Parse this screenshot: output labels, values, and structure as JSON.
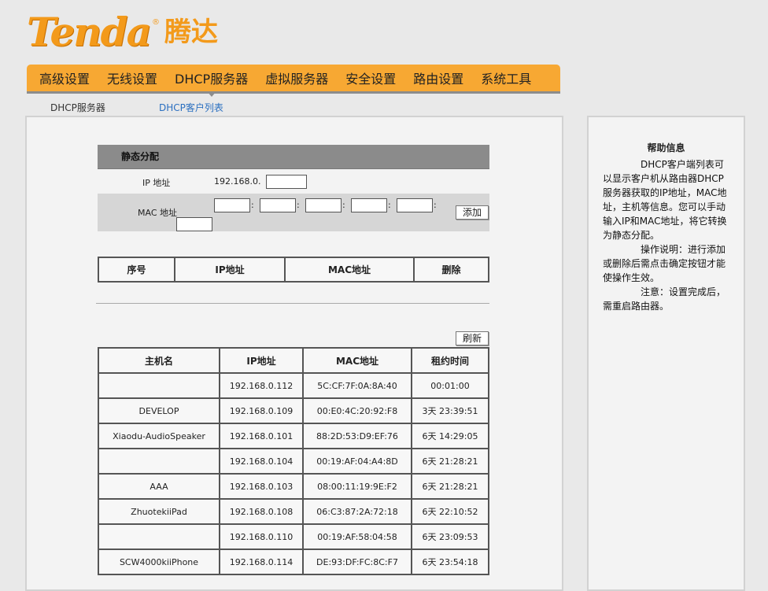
{
  "logo": {
    "brand_en": "Tenda",
    "reg_mark": "®",
    "brand_cn": "腾达"
  },
  "nav": {
    "items": [
      {
        "label": "高级设置"
      },
      {
        "label": "无线设置"
      },
      {
        "label": "DHCP服务器",
        "active": true
      },
      {
        "label": "虚拟服务器"
      },
      {
        "label": "安全设置"
      },
      {
        "label": "路由设置"
      },
      {
        "label": "系统工具"
      }
    ]
  },
  "subnav": {
    "server": "DHCP服务器",
    "client_list": "DHCP客户列表"
  },
  "static_alloc": {
    "title": "静态分配",
    "ip_label": "IP 地址",
    "ip_prefix": "192.168.0.",
    "ip_value": "",
    "mac_label": "MAC 地址",
    "mac_values": [
      "",
      "",
      "",
      "",
      "",
      ""
    ],
    "add_button": "添加"
  },
  "static_table": {
    "headers": [
      "序号",
      "IP地址",
      "MAC地址",
      "删除"
    ]
  },
  "refresh_button": "刷新",
  "client_table": {
    "headers": [
      "主机名",
      "IP地址",
      "MAC地址",
      "租约时间"
    ],
    "rows": [
      [
        "",
        "192.168.0.112",
        "5C:CF:7F:0A:8A:40",
        "00:01:00"
      ],
      [
        "DEVELOP",
        "192.168.0.109",
        "00:E0:4C:20:92:F8",
        "3天 23:39:51"
      ],
      [
        "Xiaodu-AudioSpeaker",
        "192.168.0.101",
        "88:2D:53:D9:EF:76",
        "6天 14:29:05"
      ],
      [
        "",
        "192.168.0.104",
        "00:19:AF:04:A4:8D",
        "6天 21:28:21"
      ],
      [
        "AAA",
        "192.168.0.103",
        "08:00:11:19:9E:F2",
        "6天 21:28:21"
      ],
      [
        "ZhuotekiiPad",
        "192.168.0.108",
        "06:C3:87:2A:72:18",
        "6天 22:10:52"
      ],
      [
        "",
        "192.168.0.110",
        "00:19:AF:58:04:58",
        "6天 23:09:53"
      ],
      [
        "SCW4000kiiPhone",
        "192.168.0.114",
        "DE:93:DF:FC:8C:F7",
        "6天 23:54:18"
      ]
    ]
  },
  "help": {
    "title": "帮助信息",
    "paragraphs": [
      "DHCP客户端列表可以显示客户机从路由器DHCP服务器获取的IP地址，MAC地址，主机等信息。您可以手动输入IP和MAC地址，将它转换为静态分配。",
      "操作说明：进行添加或删除后需点击确定按钮才能使操作生效。",
      "注意：设置完成后，需重启路由器。"
    ]
  }
}
